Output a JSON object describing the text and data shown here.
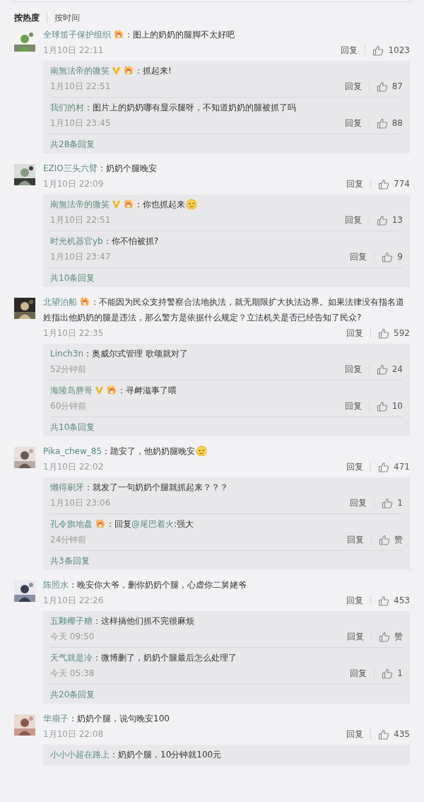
{
  "tabs": [
    {
      "label": "按热度",
      "selected": true
    },
    {
      "label": "按时间",
      "selected": false
    }
  ],
  "comments": [
    {
      "avatar": {
        "kind": "picture"
      },
      "user": "全球笛子保护组织",
      "medal": true,
      "text": "：图上的奶奶的腿脚不太好吧",
      "time": "1月10日 22:11",
      "reply_label": "回复",
      "likes": "1023",
      "replies": [
        {
          "user": "南無法帝的微笑",
          "vip": true,
          "medal": true,
          "text": "：抓起来!",
          "time": "1月10日 22:51",
          "reply_label": "回复",
          "likes": "87"
        },
        {
          "user": "我们的村",
          "text": "：图片上的奶奶哪有显示腿呀，不知道奶奶的腿被抓了吗",
          "time": "1月10日 23:45",
          "reply_label": "回复",
          "likes": "88"
        }
      ],
      "more": "共28条回复"
    },
    {
      "avatar": {
        "kind": "picture"
      },
      "user": "EZIO三头六臂",
      "text": "：奶奶个腿晚安",
      "time": "1月10日 22:09",
      "reply_label": "回复",
      "likes": "774",
      "replies": [
        {
          "user": "南無法帝的微笑",
          "vip": true,
          "medal": true,
          "text": "：你也抓起来",
          "emoji": true,
          "time": "1月10日 22:51",
          "reply_label": "回复",
          "likes": "13"
        },
        {
          "user": "时光机器官yb",
          "text": "：你不怕被抓?",
          "time": "1月10日 23:47",
          "reply_label": "回复",
          "likes": "9"
        }
      ],
      "more": "共10条回复"
    },
    {
      "avatar": {
        "kind": "picture"
      },
      "user": "北望泊船",
      "medal": true,
      "text": "：不能因为民众支持警察合法地执法，就无期限扩大执法边界。如果法律没有指名道姓指出他奶奶的腿是违法，那么警方是依据什么规定？立法机关是否已经告知了民众?",
      "time": "1月10日 22:35",
      "reply_label": "回复",
      "likes": "592",
      "replies": [
        {
          "user": "Linch3n",
          "text": "：奥威尔式管理 歌颂就对了",
          "time": "52分钟前",
          "reply_label": "回复",
          "likes": "24"
        },
        {
          "user": "海陵岛胖哥",
          "vip": true,
          "medal": true,
          "text": "：寻衅滋事了喂",
          "time": "60分钟前",
          "reply_label": "回复",
          "likes": "10"
        }
      ],
      "more": "共10条回复"
    },
    {
      "avatar": {
        "kind": "picture"
      },
      "user": "Pika_chew_85",
      "text": "：跪安了，他奶奶腿晚安",
      "emoji": true,
      "time": "1月10日 22:02",
      "reply_label": "回复",
      "likes": "471",
      "replies": [
        {
          "user": "懒得刷牙",
          "text": "：就发了一句奶奶个腿就抓起来？？？",
          "time": "1月10日 23:06",
          "reply_label": "回复",
          "likes": "1"
        },
        {
          "user": "孔令旗地盘",
          "medal": true,
          "text": [
            {
              "kind": "plain",
              "text": "：回复"
            },
            {
              "kind": "mention",
              "text": "@尾巴着火"
            },
            {
              "kind": "plain",
              "text": ":强大"
            }
          ],
          "time": "24分钟前",
          "reply_label": "回复",
          "likes": "赞"
        }
      ],
      "more": "共3条回复"
    },
    {
      "avatar": {
        "kind": "picture"
      },
      "user": "陈照水",
      "text": "：晚安你大爷，删你奶奶个腿，心虚你二舅姥爷",
      "time": "1月10日 22:26",
      "reply_label": "回复",
      "likes": "453",
      "replies": [
        {
          "user": "五颗椰子糖",
          "text": "：这样搞他们抓不完很麻烦",
          "time": "今天 09:50",
          "reply_label": "回复",
          "likes": "赞"
        },
        {
          "user": "天气就是冷",
          "text": "：微博删了，奶奶个腿最后怎么处理了",
          "time": "今天 05:38",
          "reply_label": "回复",
          "likes": "1"
        }
      ],
      "more": "共20条回复"
    },
    {
      "avatar": {
        "kind": "picture"
      },
      "user": "华扇子",
      "text": "：奶奶个腿，说句晚安100",
      "time": "1月10日 22:08",
      "reply_label": "回复",
      "likes": "435",
      "replies": [
        {
          "user": "小小小超在路上",
          "text": "：奶奶个腿，10分钟就100元"
        }
      ]
    }
  ]
}
